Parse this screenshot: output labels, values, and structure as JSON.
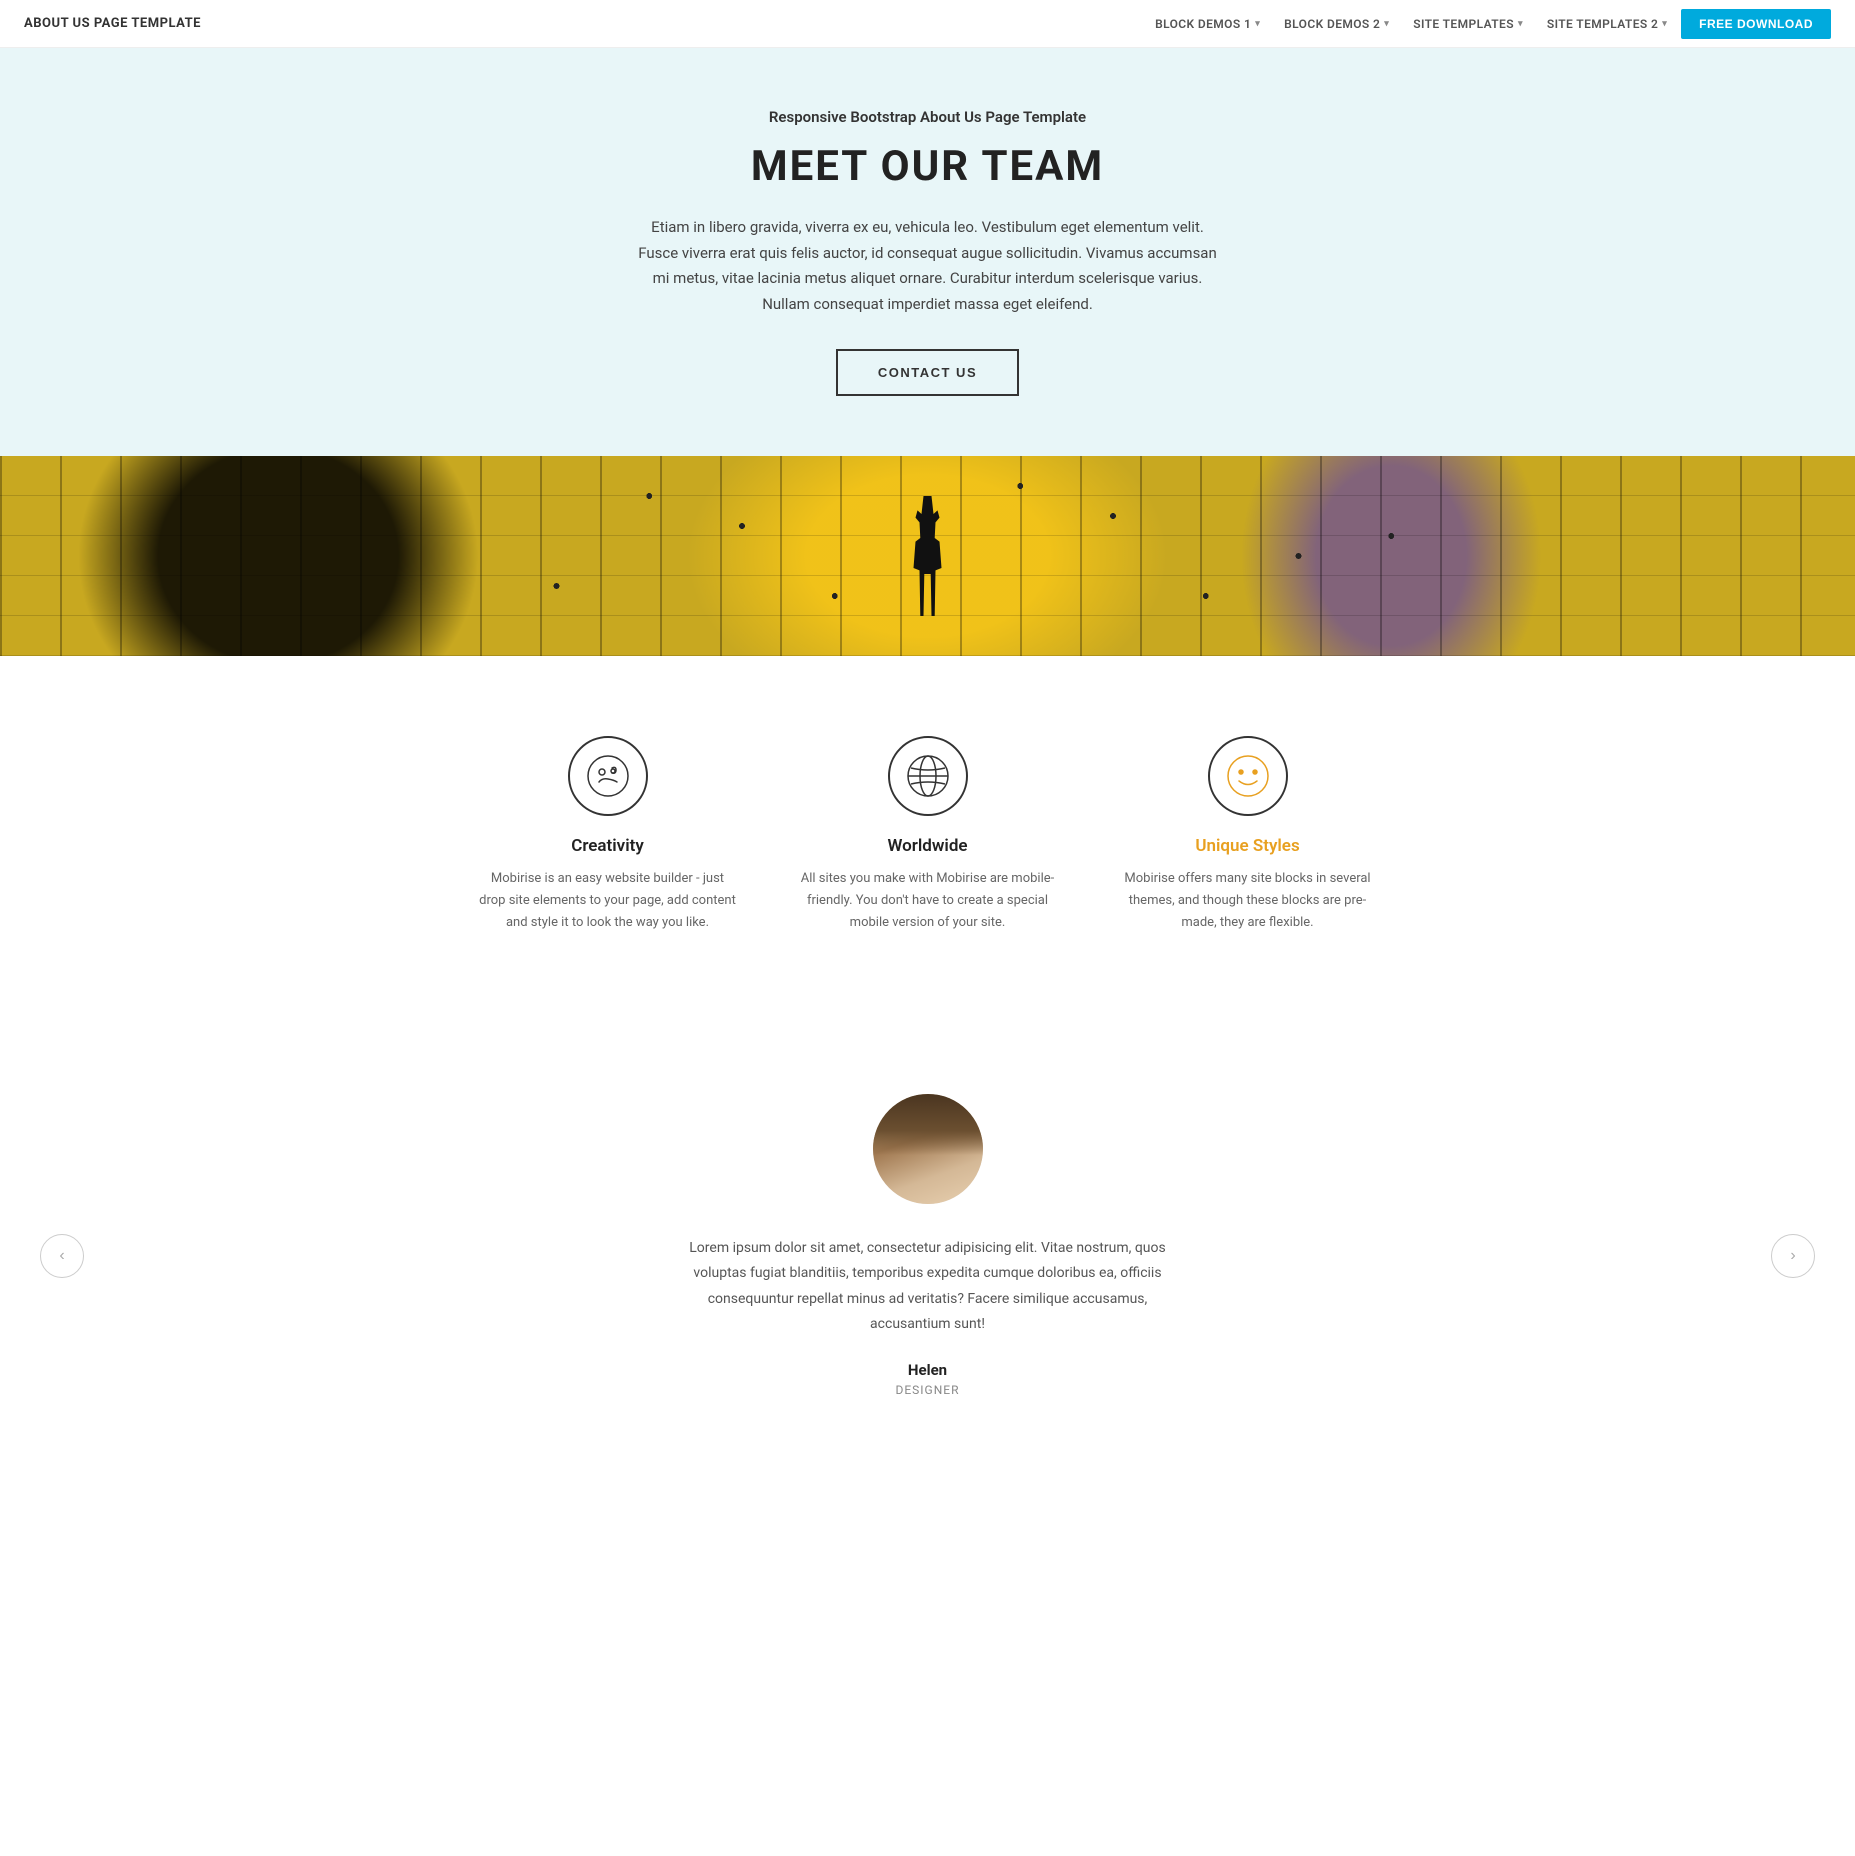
{
  "nav": {
    "brand": "ABOUT US PAGE TEMPLATE",
    "items": [
      {
        "label": "BLOCK DEMOS 1",
        "hasDropdown": true
      },
      {
        "label": "BLOCK DEMOS 2",
        "hasDropdown": true
      },
      {
        "label": "SITE TEMPLATES",
        "hasDropdown": true
      },
      {
        "label": "SITE TEMPLATES 2",
        "hasDropdown": true
      }
    ],
    "cta": "FREE DOWNLOAD"
  },
  "hero": {
    "subtitle": "Responsive Bootstrap About Us Page Template",
    "title": "MEET OUR TEAM",
    "description": "Etiam in libero gravida, viverra ex eu, vehicula leo. Vestibulum eget elementum velit. Fusce viverra erat quis felis auctor, id consequat augue sollicitudin. Vivamus accumsan mi metus, vitae lacinia metus aliquet ornare. Curabitur interdum scelerisque varius. Nullam consequat imperdiet massa eget eleifend.",
    "cta": "CONTACT US"
  },
  "features": [
    {
      "title": "Creativity",
      "highlight": false,
      "description": "Mobirise is an easy website builder - just drop site elements to your page, add content and style it to look the way you like.",
      "icon": "creativity"
    },
    {
      "title": "Worldwide",
      "highlight": false,
      "description": "All sites you make with Mobirise are mobile-friendly. You don't have to create a special mobile version of your site.",
      "icon": "worldwide"
    },
    {
      "title": "Unique Styles",
      "highlight": true,
      "description": "Mobirise offers many site blocks in several themes, and though these blocks are pre-made, they are flexible.",
      "icon": "unique-styles"
    }
  ],
  "testimonial": {
    "text": "Lorem ipsum dolor sit amet, consectetur adipisicing elit. Vitae nostrum, quos voluptas fugiat blanditiis, temporibus expedita cumque doloribus ea, officiis consequuntur repellat minus ad veritatis? Facere similique accusamus, accusantium sunt!",
    "name": "Helen",
    "role": "DESIGNER",
    "prev_label": "‹",
    "next_label": "›"
  }
}
